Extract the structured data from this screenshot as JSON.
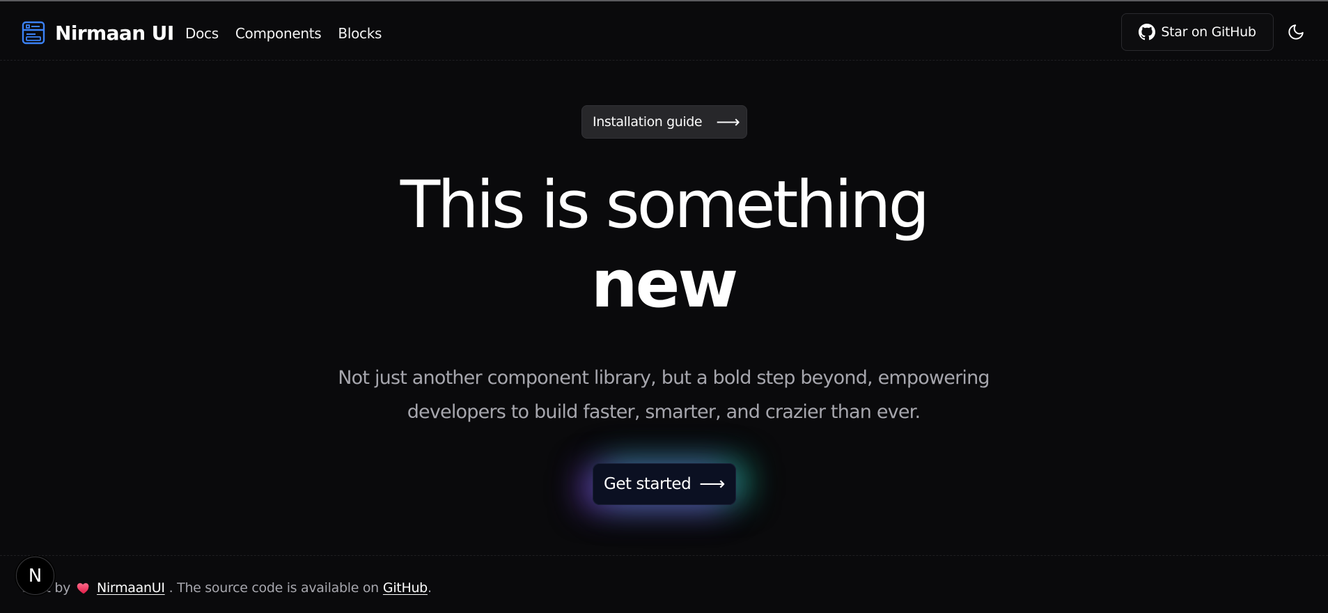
{
  "header": {
    "brand_name": "Nirmaan UI",
    "nav": [
      {
        "label": "Docs"
      },
      {
        "label": "Components"
      },
      {
        "label": "Blocks"
      }
    ],
    "github_button_label": "Star on GitHub",
    "logo_icon": "layout-panel-icon",
    "theme_icon": "moon-icon"
  },
  "hero": {
    "install_pill_label": "Installation guide",
    "install_pill_arrow": "⟶",
    "title_line1": "This is something",
    "title_line2": "new",
    "subtitle_line1": "Not just another component library, but a bold step beyond, empowering",
    "subtitle_line2": "developers to build faster, smarter, and crazier than ever.",
    "cta_label": "Get started",
    "cta_arrow": "⟶"
  },
  "footer": {
    "prefix": "Built by",
    "author_link": "NirmaanUI",
    "middle": ". The source code is available on",
    "github_link": "GitHub",
    "suffix": "."
  },
  "badge": {
    "letter": "N"
  },
  "colors": {
    "background": "#0a0a0c",
    "accent_blue": "#3b82f6",
    "muted_text": "#a6a6ad",
    "heart": "#f43f5e",
    "glow_purple": "#8246dc",
    "glow_green": "#1ec896"
  }
}
